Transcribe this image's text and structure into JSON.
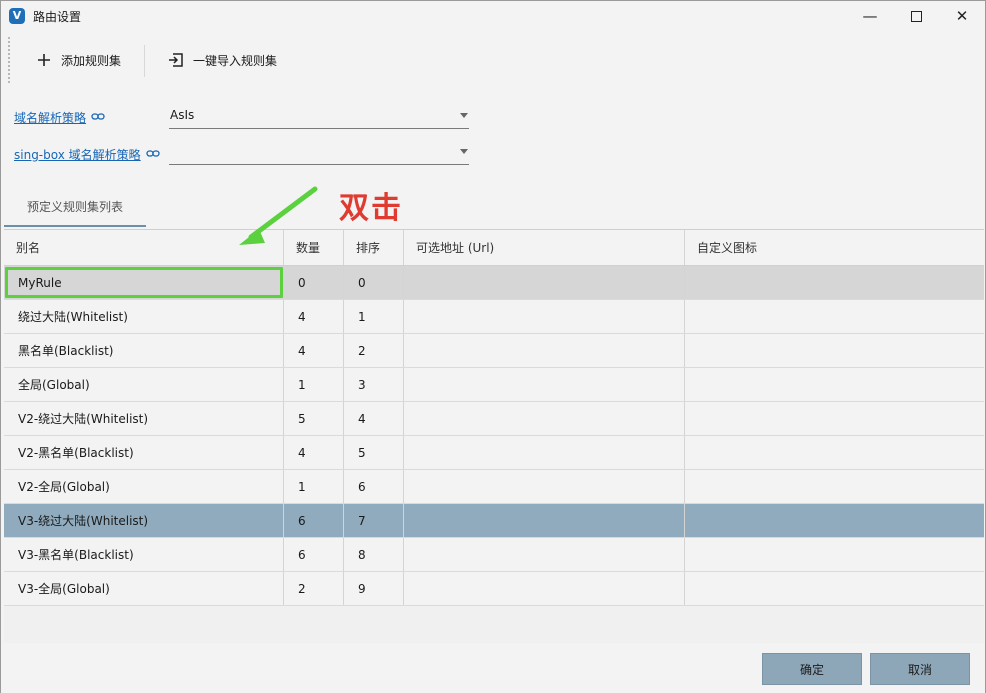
{
  "window": {
    "title": "路由设置",
    "app_icon": "V",
    "controls": {
      "minimize": "—",
      "maximize": "",
      "close": "✕"
    }
  },
  "toolbar": {
    "add_label": "添加规则集",
    "import_label": "一键导入规则集"
  },
  "form": {
    "domain_strategy_label": "域名解析策略",
    "domain_strategy_value": "AsIs",
    "singbox_strategy_label": "sing-box 域名解析策略",
    "singbox_strategy_value": ""
  },
  "tabs": [
    {
      "label": "预定义规则集列表"
    }
  ],
  "grid": {
    "columns": [
      "别名",
      "数量",
      "排序",
      "可选地址 (Url)",
      "自定义图标"
    ],
    "rows": [
      {
        "alias": "MyRule",
        "count": "0",
        "order": "0",
        "url": "",
        "icon": ""
      },
      {
        "alias": "绕过大陆(Whitelist)",
        "count": "4",
        "order": "1",
        "url": "",
        "icon": ""
      },
      {
        "alias": "黑名单(Blacklist)",
        "count": "4",
        "order": "2",
        "url": "",
        "icon": ""
      },
      {
        "alias": "全局(Global)",
        "count": "1",
        "order": "3",
        "url": "",
        "icon": ""
      },
      {
        "alias": "V2-绕过大陆(Whitelist)",
        "count": "5",
        "order": "4",
        "url": "",
        "icon": ""
      },
      {
        "alias": "V2-黑名单(Blacklist)",
        "count": "4",
        "order": "5",
        "url": "",
        "icon": ""
      },
      {
        "alias": "V2-全局(Global)",
        "count": "1",
        "order": "6",
        "url": "",
        "icon": ""
      },
      {
        "alias": "V3-绕过大陆(Whitelist)",
        "count": "6",
        "order": "7",
        "url": "",
        "icon": ""
      },
      {
        "alias": "V3-黑名单(Blacklist)",
        "count": "6",
        "order": "8",
        "url": "",
        "icon": ""
      },
      {
        "alias": "V3-全局(Global)",
        "count": "2",
        "order": "9",
        "url": "",
        "icon": ""
      }
    ]
  },
  "footer": {
    "ok_label": "确定",
    "cancel_label": "取消"
  },
  "annotation": {
    "text": "双击",
    "text_color": "#e03b30",
    "arrow_color": "#5bd13f"
  },
  "colors": {
    "selected_row": "#8fabbd",
    "focused_row": "#d6d6d6",
    "link": "#1766b6"
  }
}
